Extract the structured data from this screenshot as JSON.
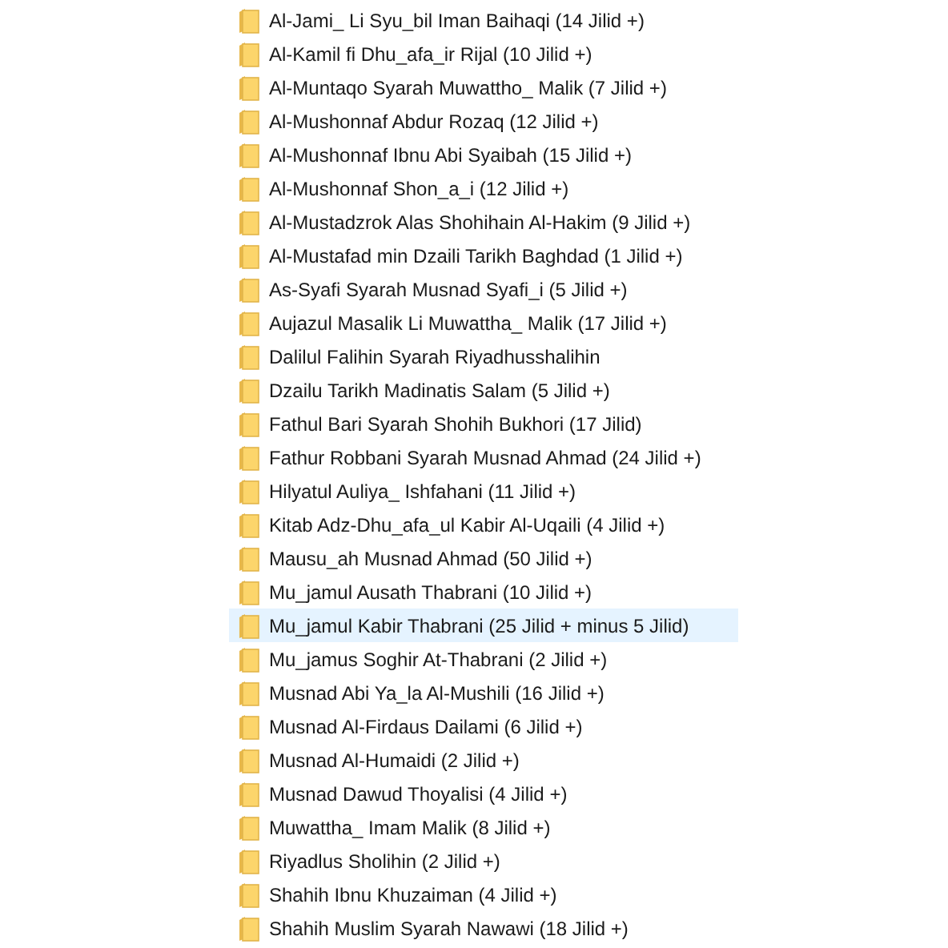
{
  "folders": [
    {
      "name": "Al-Jami_ Li Syu_bil Iman Baihaqi (14 Jilid +)",
      "selected": false
    },
    {
      "name": "Al-Kamil fi Dhu_afa_ir Rijal (10 Jilid +)",
      "selected": false
    },
    {
      "name": "Al-Muntaqo Syarah Muwattho_ Malik (7 Jilid +)",
      "selected": false
    },
    {
      "name": "Al-Mushonnaf Abdur Rozaq (12 Jilid +)",
      "selected": false
    },
    {
      "name": "Al-Mushonnaf Ibnu Abi Syaibah (15 Jilid +)",
      "selected": false
    },
    {
      "name": "Al-Mushonnaf Shon_a_i (12 Jilid +)",
      "selected": false
    },
    {
      "name": "Al-Mustadzrok Alas Shohihain Al-Hakim (9 Jilid +)",
      "selected": false
    },
    {
      "name": "Al-Mustafad min Dzaili Tarikh Baghdad (1 Jilid +)",
      "selected": false
    },
    {
      "name": "As-Syafi Syarah Musnad Syafi_i (5 Jilid +)",
      "selected": false
    },
    {
      "name": "Aujazul Masalik Li Muwattha_ Malik (17 Jilid +)",
      "selected": false
    },
    {
      "name": "Dalilul Falihin Syarah Riyadhusshalihin",
      "selected": false
    },
    {
      "name": "Dzailu Tarikh Madinatis Salam (5 Jilid +)",
      "selected": false
    },
    {
      "name": "Fathul Bari Syarah Shohih Bukhori (17 Jilid)",
      "selected": false
    },
    {
      "name": "Fathur Robbani Syarah Musnad Ahmad (24 Jilid +)",
      "selected": false
    },
    {
      "name": "Hilyatul Auliya_ Ishfahani (11 Jilid +)",
      "selected": false
    },
    {
      "name": "Kitab Adz-Dhu_afa_ul Kabir Al-Uqaili (4 Jilid +)",
      "selected": false
    },
    {
      "name": "Mausu_ah Musnad Ahmad (50 Jilid +)",
      "selected": false
    },
    {
      "name": "Mu_jamul Ausath Thabrani (10 Jilid +)",
      "selected": false
    },
    {
      "name": "Mu_jamul Kabir Thabrani (25 Jilid + minus 5 Jilid)",
      "selected": true
    },
    {
      "name": "Mu_jamus Soghir At-Thabrani (2 Jilid +)",
      "selected": false
    },
    {
      "name": "Musnad Abi Ya_la Al-Mushili (16 Jilid +)",
      "selected": false
    },
    {
      "name": "Musnad Al-Firdaus Dailami (6 Jilid +)",
      "selected": false
    },
    {
      "name": "Musnad Al-Humaidi (2 Jilid +)",
      "selected": false
    },
    {
      "name": "Musnad Dawud Thoyalisi (4 Jilid +)",
      "selected": false
    },
    {
      "name": "Muwattha_ Imam Malik (8 Jilid +)",
      "selected": false
    },
    {
      "name": "Riyadlus Sholihin (2 Jilid +)",
      "selected": false
    },
    {
      "name": "Shahih Ibnu Khuzaiman (4 Jilid +)",
      "selected": false
    },
    {
      "name": "Shahih Muslim Syarah Nawawi (18 Jilid +)",
      "selected": false
    }
  ]
}
